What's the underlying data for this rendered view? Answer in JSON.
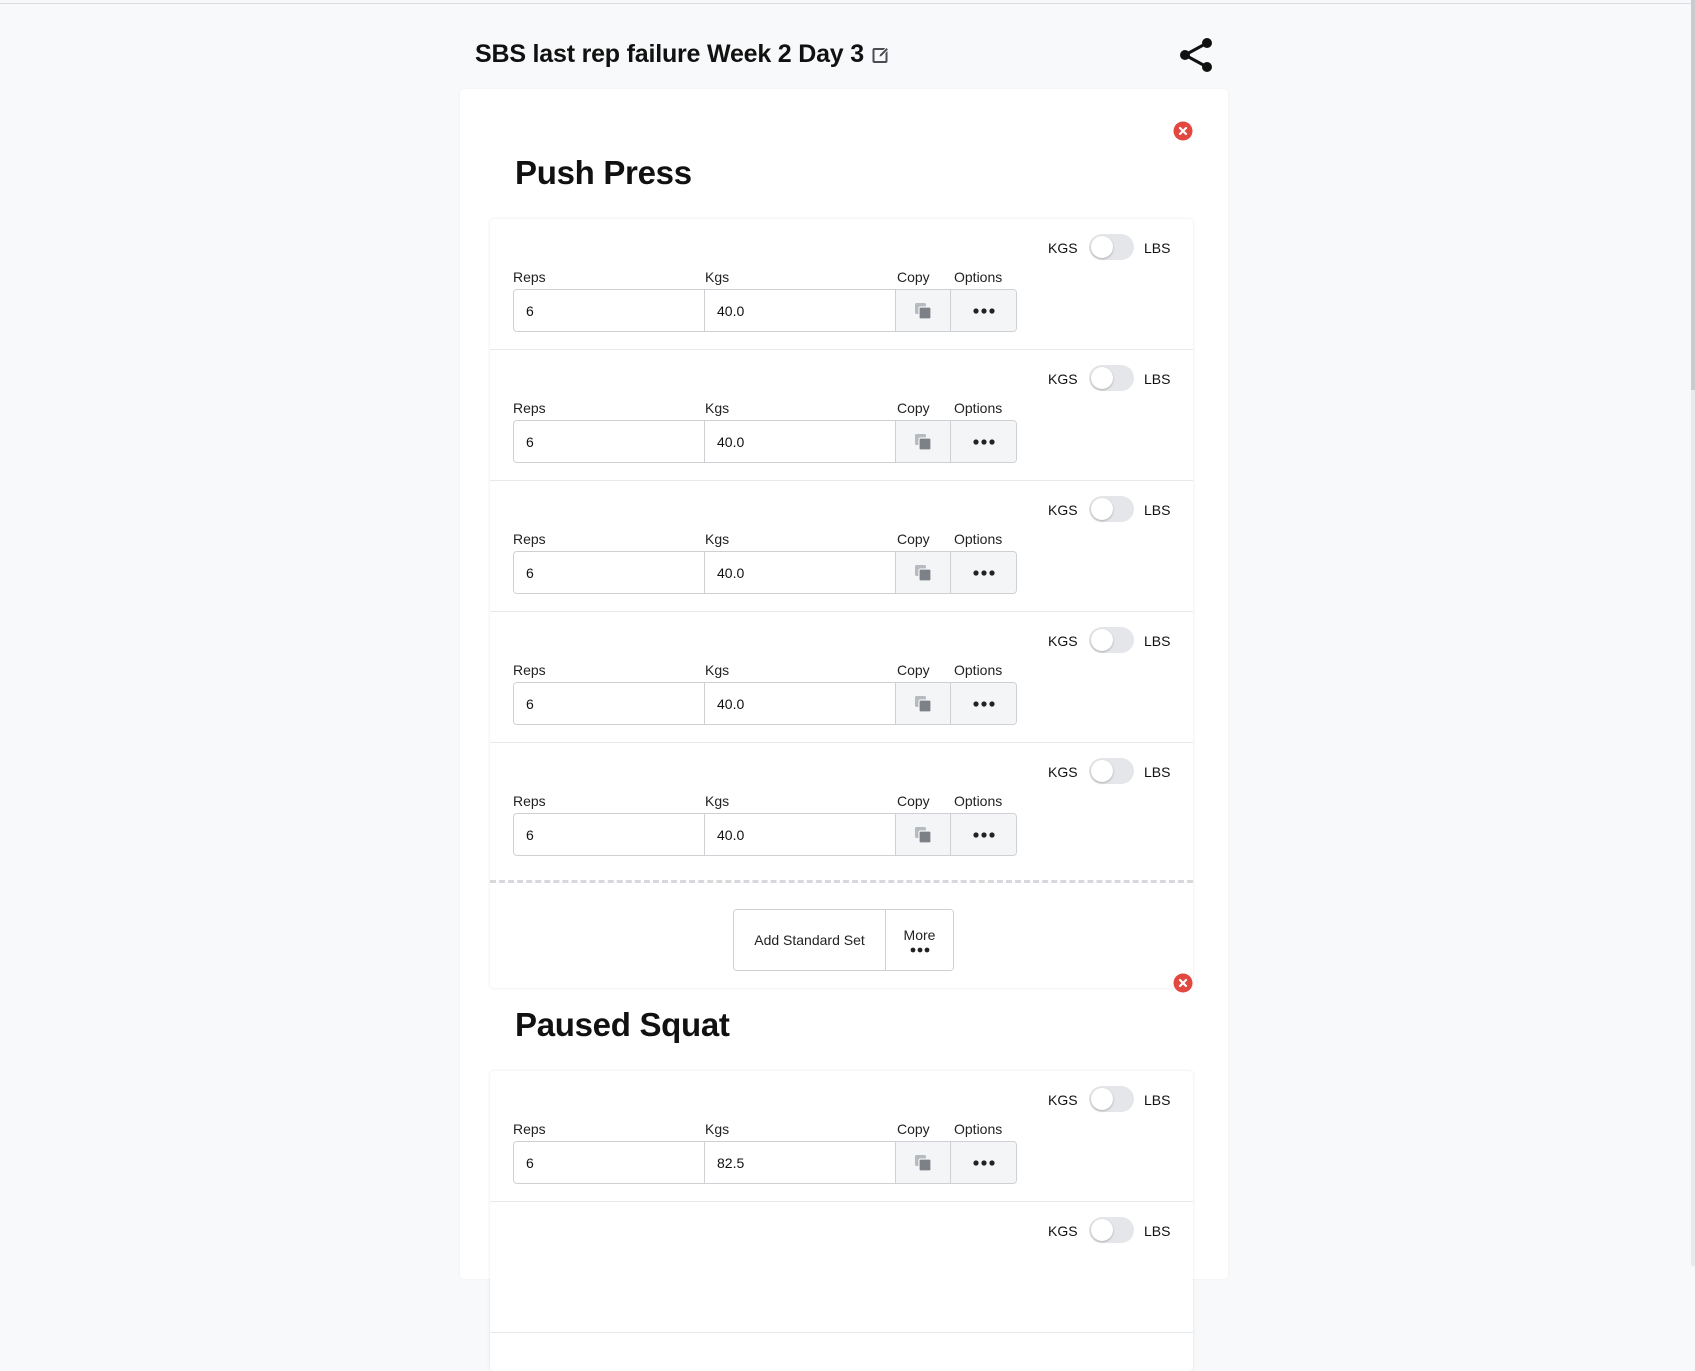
{
  "page_title": "SBS last rep failure Week 2 Day 3",
  "icons": {
    "edit": "pencil-square-icon",
    "share": "share-icon",
    "remove": "remove-circle-x-icon",
    "copy": "copy-icon",
    "options": "ellipsis-icon"
  },
  "colors": {
    "remove_red": "#e2483f",
    "page_bg": "#f8f9fa"
  },
  "labels": {
    "reps": "Reps",
    "kgs": "Kgs",
    "copy": "Copy",
    "options": "Options",
    "unit_kgs": "KGS",
    "unit_lbs": "LBS",
    "add_standard_set": "Add Standard Set",
    "more": "More"
  },
  "exercises": [
    {
      "name": "Push Press",
      "sets": [
        {
          "reps": "6",
          "kgs": "40.0"
        },
        {
          "reps": "6",
          "kgs": "40.0"
        },
        {
          "reps": "6",
          "kgs": "40.0"
        },
        {
          "reps": "6",
          "kgs": "40.0"
        },
        {
          "reps": "6",
          "kgs": "40.0"
        }
      ]
    },
    {
      "name": "Paused Squat",
      "sets": [
        {
          "reps": "6",
          "kgs": "82.5"
        },
        {
          "reps": "",
          "kgs": ""
        }
      ]
    }
  ]
}
